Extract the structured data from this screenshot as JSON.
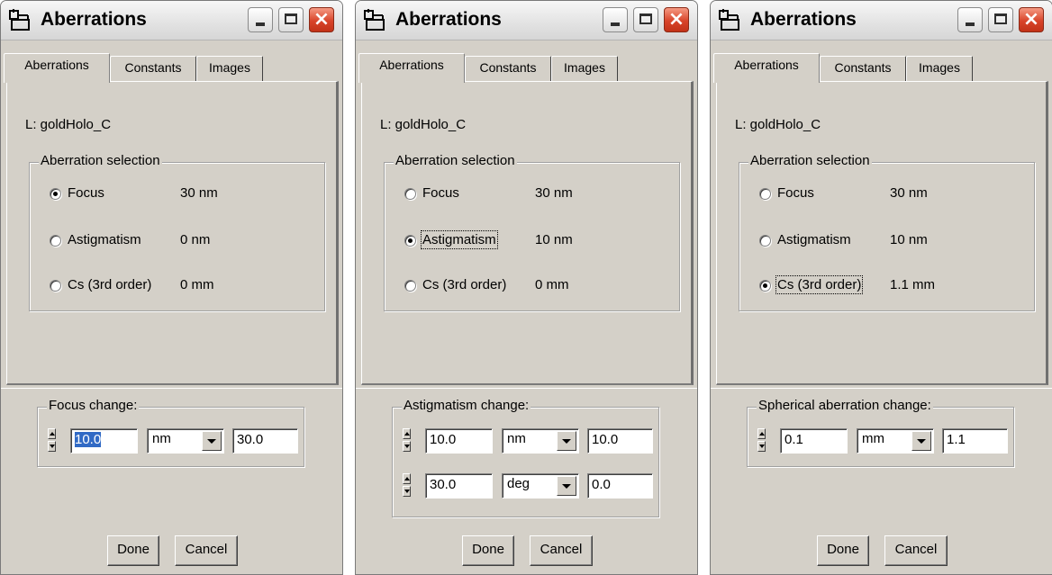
{
  "windows": [
    {
      "title": "Aberrations",
      "tabs": [
        "Aberrations",
        "Constants",
        "Images"
      ],
      "file_label": "L: goldHolo_C",
      "group_title": "Aberration selection",
      "options": [
        {
          "label": "Focus",
          "value": "30 nm",
          "selected": true
        },
        {
          "label": "Astigmatism",
          "value": "0 nm",
          "selected": false
        },
        {
          "label": "Cs (3rd order)",
          "value": "0 mm",
          "selected": false
        }
      ],
      "change_title": "Focus change:",
      "rows": [
        {
          "step": "10.0",
          "unit": "nm",
          "result": "30.0"
        }
      ],
      "done_label": "Done",
      "cancel_label": "Cancel"
    },
    {
      "title": "Aberrations",
      "tabs": [
        "Aberrations",
        "Constants",
        "Images"
      ],
      "file_label": "L: goldHolo_C",
      "group_title": "Aberration selection",
      "options": [
        {
          "label": "Focus",
          "value": "30 nm",
          "selected": false
        },
        {
          "label": "Astigmatism",
          "value": "10 nm",
          "selected": true
        },
        {
          "label": "Cs (3rd order)",
          "value": "0 mm",
          "selected": false
        }
      ],
      "change_title": "Astigmatism change:",
      "rows": [
        {
          "step": "10.0",
          "unit": "nm",
          "result": "10.0"
        },
        {
          "step": "30.0",
          "unit": "deg",
          "result": "0.0"
        }
      ],
      "done_label": "Done",
      "cancel_label": "Cancel"
    },
    {
      "title": "Aberrations",
      "tabs": [
        "Aberrations",
        "Constants",
        "Images"
      ],
      "file_label": "L: goldHolo_C",
      "group_title": "Aberration selection",
      "options": [
        {
          "label": "Focus",
          "value": "30 nm",
          "selected": false
        },
        {
          "label": "Astigmatism",
          "value": "10 nm",
          "selected": false
        },
        {
          "label": "Cs (3rd order)",
          "value": "1.1 mm",
          "selected": true
        }
      ],
      "change_title": "Spherical aberration change:",
      "rows": [
        {
          "step": "0.1",
          "unit": "mm",
          "result": "1.1"
        }
      ],
      "done_label": "Done",
      "cancel_label": "Cancel"
    }
  ]
}
